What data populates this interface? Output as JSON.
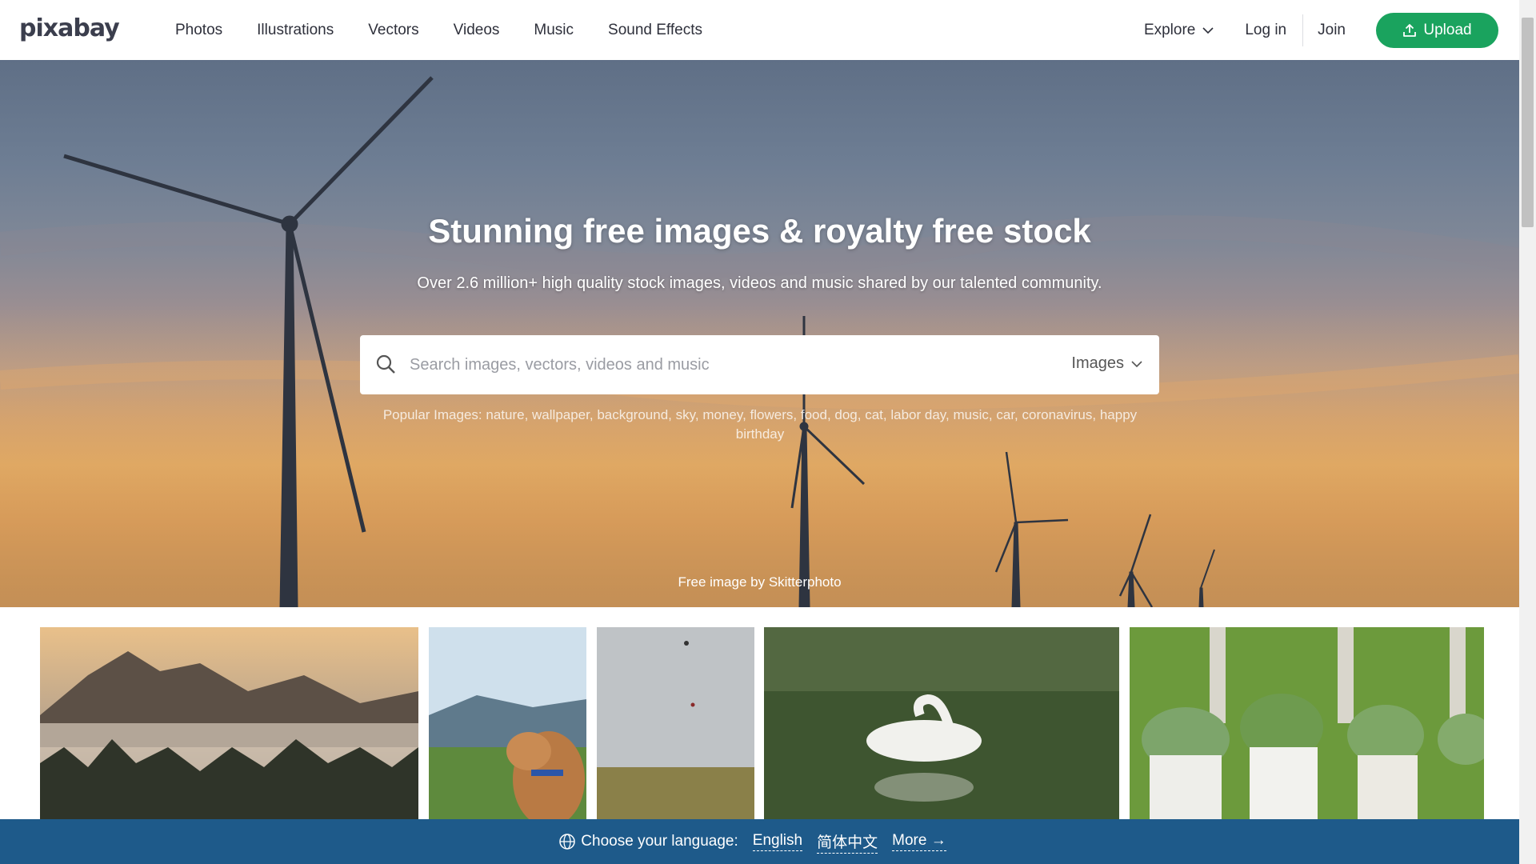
{
  "header": {
    "logo": "pixabay",
    "nav": [
      "Photos",
      "Illustrations",
      "Vectors",
      "Videos",
      "Music",
      "Sound Effects"
    ],
    "explore": "Explore",
    "login": "Log in",
    "join": "Join",
    "upload": "Upload"
  },
  "hero": {
    "title": "Stunning free images & royalty free stock",
    "subtitle": "Over 2.6 million+ high quality stock images, videos and music shared by our talented community.",
    "search_placeholder": "Search images, vectors, videos and music",
    "search_type": "Images",
    "popular_label": "Popular Images:",
    "popular_tags": [
      "nature",
      "wallpaper",
      "background",
      "sky",
      "money",
      "flowers",
      "food",
      "dog",
      "cat",
      "labor day",
      "music",
      "car",
      "coronavirus",
      "happy birthday"
    ],
    "credit": "Free image by Skitterphoto"
  },
  "language_bar": {
    "label": "Choose your language:",
    "languages": [
      "English",
      "简体中文"
    ],
    "more": "More →"
  },
  "colors": {
    "accent": "#1aa35e",
    "lang_bar": "#1e5a8a"
  }
}
